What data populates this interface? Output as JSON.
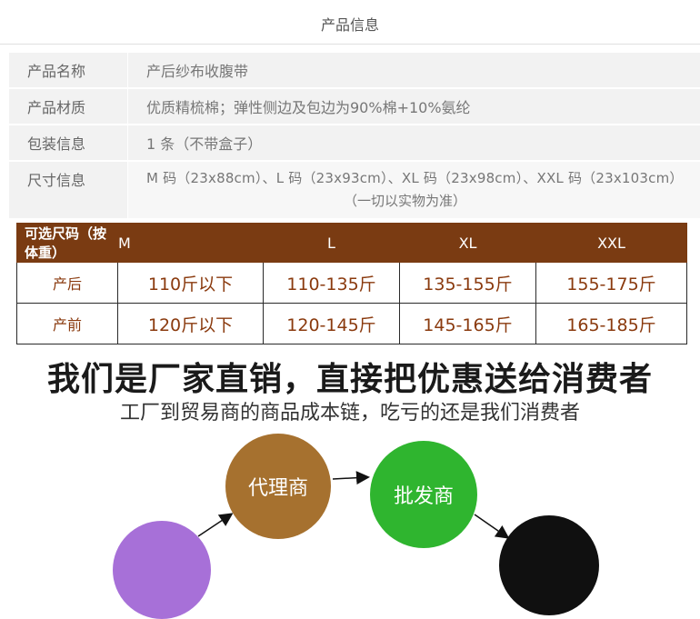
{
  "section_title": "产品信息",
  "info": [
    {
      "key": "产品名称",
      "value": "产后纱布收腹带"
    },
    {
      "key": "产品材质",
      "value": "优质精梳棉；弹性侧边及包边为90%棉+10%氨纶"
    },
    {
      "key": "包装信息",
      "value": "1 条（不带盒子）"
    },
    {
      "key": "尺寸信息",
      "value": "M 码（23x88cm）、L 码（23x93cm）、XL 码（23x98cm）、XXL 码（23x103cm）",
      "note": "（一切以实物为准）"
    }
  ],
  "size_table": {
    "headers": [
      "可选尺码（按体重）",
      "M",
      "L",
      "XL",
      "XXL"
    ],
    "rows": [
      {
        "label": "产后",
        "cells": [
          "110斤以下",
          "110-135斤",
          "135-155斤",
          "155-175斤"
        ]
      },
      {
        "label": "产前",
        "cells": [
          "120斤以下",
          "120-145斤",
          "145-165斤",
          "165-185斤"
        ]
      }
    ]
  },
  "headline": "我们是厂家直销，直接把优惠送给消费者",
  "subline": "工厂到贸易商的商品成本链，吃亏的还是我们消费者",
  "flow": {
    "agent": "代理商",
    "wholesale": "批发商"
  },
  "colors": {
    "table_header": "#7a3b12",
    "table_text": "#8a3a0e",
    "agent_circle": "#a6712f",
    "wholesale_circle": "#2fb52f",
    "purple_circle": "#a770d8",
    "black_circle": "#101010"
  }
}
